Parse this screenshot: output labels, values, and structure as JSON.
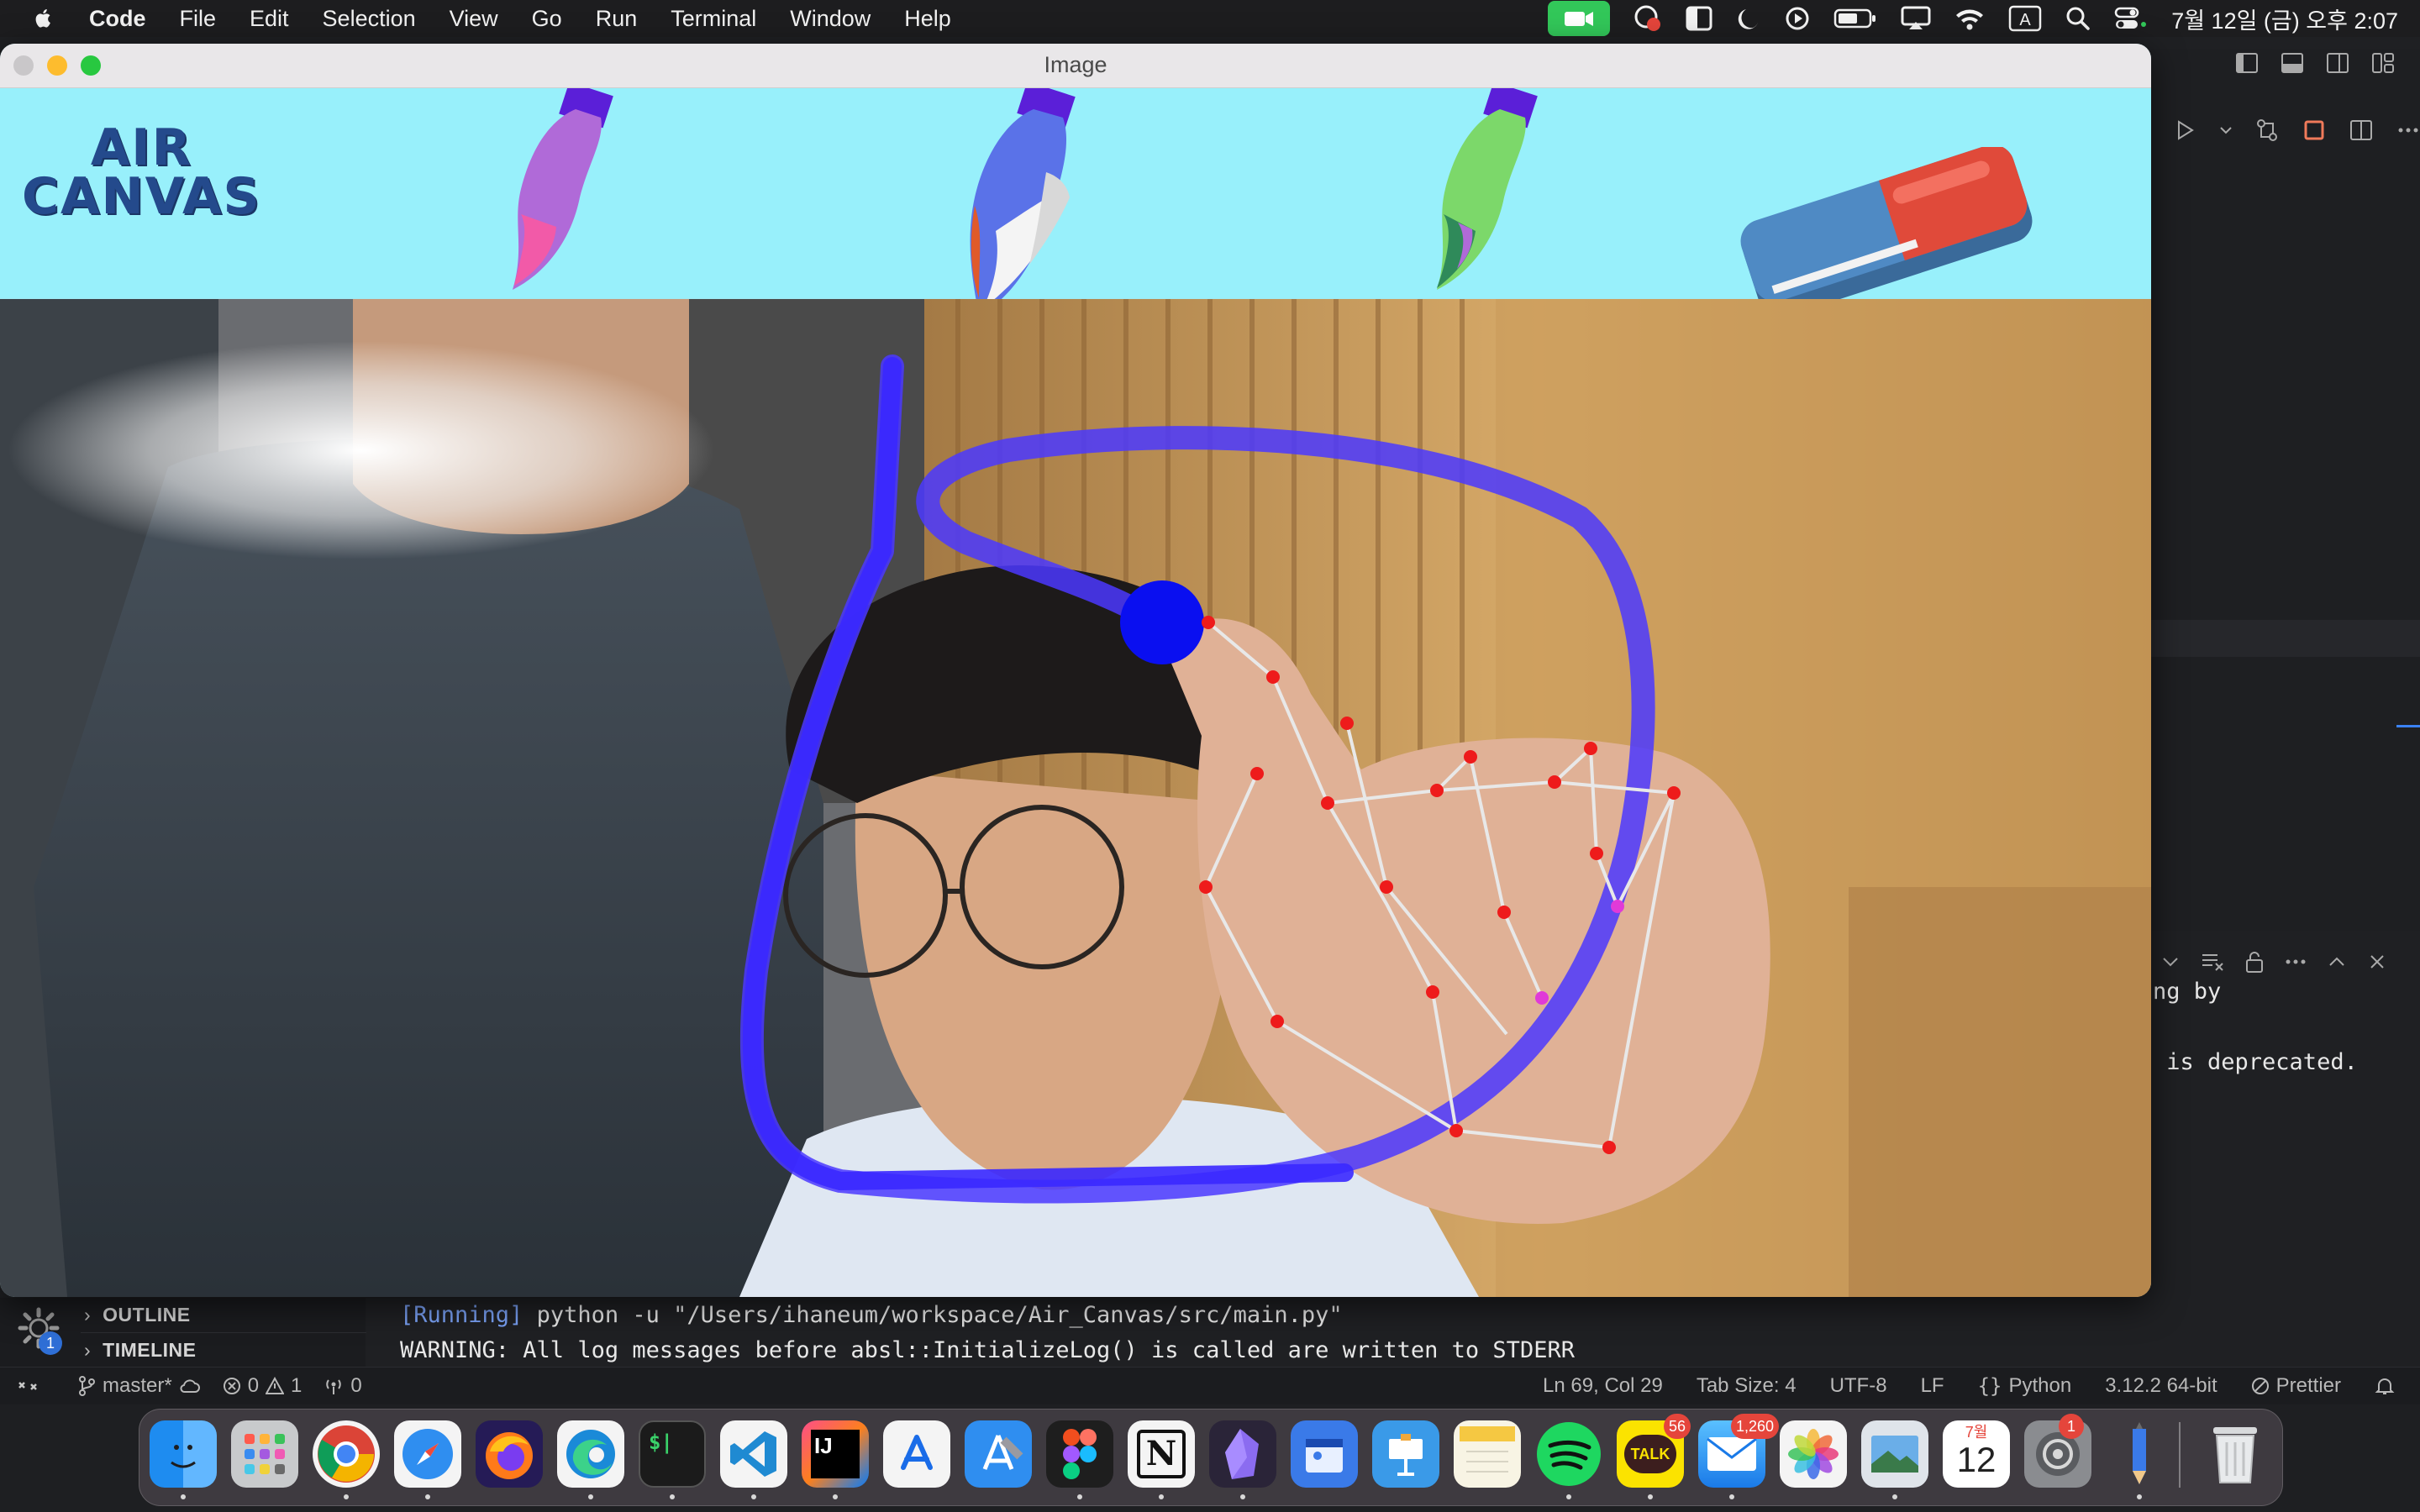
{
  "menubar": {
    "app_name": "Code",
    "menus": [
      "File",
      "Edit",
      "Selection",
      "View",
      "Go",
      "Run",
      "Terminal",
      "Window",
      "Help"
    ],
    "input_source": "A",
    "clock": "7월 12일 (금) 오후 2:07"
  },
  "image_window": {
    "title": "Image",
    "logo_line1": "AIR",
    "logo_line2": "CANVAS",
    "tools": [
      "purple-brush",
      "blue-brush",
      "green-brush",
      "eraser"
    ]
  },
  "terminal": {
    "right_line1": "ng by",
    "right_line2": " is deprecated.",
    "running_tag": "[Running]",
    "command": " python -u \"/Users/ihaneum/workspace/Air_Canvas/src/main.py\"",
    "warning": "WARNING: All log messages before absl::InitializeLog() is called are written to STDERR"
  },
  "sidebar": {
    "outline_label": "OUTLINE",
    "timeline_label": "TIMELINE",
    "gear_badge": "1"
  },
  "statusbar": {
    "branch": "master*",
    "errors": "0",
    "warnings": "1",
    "ports": "0",
    "cursor": "Ln 69, Col 29",
    "tab_size": "Tab Size: 4",
    "encoding": "UTF-8",
    "eol": "LF",
    "language": "Python",
    "interpreter": "3.12.2 64-bit",
    "formatter": "Prettier"
  },
  "dock": {
    "badges": {
      "slack": "56",
      "mail": "1,260",
      "settings": "1"
    },
    "calendar_month": "7월",
    "calendar_day": "12",
    "notion_letter": "N",
    "intellij_letters": "IJ",
    "talk_label": "TALK"
  },
  "colors": {
    "canvas_bg": "#98f0fb",
    "stroke": "#5a4bff",
    "pointer": "#0a0ff0",
    "landmark": "#e02020"
  }
}
